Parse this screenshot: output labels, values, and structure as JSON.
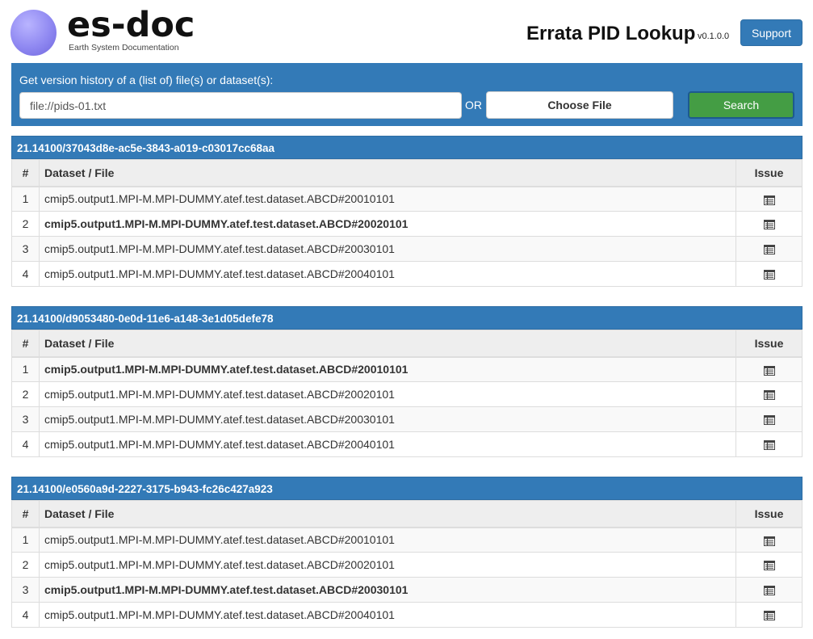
{
  "header": {
    "logo_title": "es-doc",
    "logo_subtitle": "Earth System Documentation",
    "app_title": "Errata PID Lookup",
    "app_version": "v0.1.0.0",
    "support_label": "Support"
  },
  "search": {
    "label": "Get version history of a (list of) file(s) or dataset(s):",
    "input_value": "file://pids-01.txt",
    "or_label": "OR",
    "choose_file_label": "Choose File",
    "search_label": "Search"
  },
  "table_headers": {
    "num": "#",
    "dataset": "Dataset / File",
    "issue": "Issue"
  },
  "results": [
    {
      "pid": "21.14100/37043d8e-ac5e-3843-a019-c03017cc68aa",
      "rows": [
        {
          "num": "1",
          "name": "cmip5.output1.MPI-M.MPI-DUMMY.atef.test.dataset.ABCD#20010101",
          "bold": false,
          "icon": "table-list-icon"
        },
        {
          "num": "2",
          "name": "cmip5.output1.MPI-M.MPI-DUMMY.atef.test.dataset.ABCD#20020101",
          "bold": true,
          "icon": "table-list-icon"
        },
        {
          "num": "3",
          "name": "cmip5.output1.MPI-M.MPI-DUMMY.atef.test.dataset.ABCD#20030101",
          "bold": false,
          "icon": "table-list-icon"
        },
        {
          "num": "4",
          "name": "cmip5.output1.MPI-M.MPI-DUMMY.atef.test.dataset.ABCD#20040101",
          "bold": false,
          "icon": "table-list-icon"
        }
      ]
    },
    {
      "pid": "21.14100/d9053480-0e0d-11e6-a148-3e1d05defe78",
      "rows": [
        {
          "num": "1",
          "name": "cmip5.output1.MPI-M.MPI-DUMMY.atef.test.dataset.ABCD#20010101",
          "bold": true,
          "icon": "table-list-icon"
        },
        {
          "num": "2",
          "name": "cmip5.output1.MPI-M.MPI-DUMMY.atef.test.dataset.ABCD#20020101",
          "bold": false,
          "icon": "table-list-icon"
        },
        {
          "num": "3",
          "name": "cmip5.output1.MPI-M.MPI-DUMMY.atef.test.dataset.ABCD#20030101",
          "bold": false,
          "icon": "table-list-icon"
        },
        {
          "num": "4",
          "name": "cmip5.output1.MPI-M.MPI-DUMMY.atef.test.dataset.ABCD#20040101",
          "bold": false,
          "icon": "table-list-icon"
        }
      ]
    },
    {
      "pid": "21.14100/e0560a9d-2227-3175-b943-fc26c427a923",
      "rows": [
        {
          "num": "1",
          "name": "cmip5.output1.MPI-M.MPI-DUMMY.atef.test.dataset.ABCD#20010101",
          "bold": false,
          "icon": "table-list-icon"
        },
        {
          "num": "2",
          "name": "cmip5.output1.MPI-M.MPI-DUMMY.atef.test.dataset.ABCD#20020101",
          "bold": false,
          "icon": "table-list-icon"
        },
        {
          "num": "3",
          "name": "cmip5.output1.MPI-M.MPI-DUMMY.atef.test.dataset.ABCD#20030101",
          "bold": true,
          "icon": "table-list-icon"
        },
        {
          "num": "4",
          "name": "cmip5.output1.MPI-M.MPI-DUMMY.atef.test.dataset.ABCD#20040101",
          "bold": false,
          "icon": "table-list-icon"
        }
      ]
    }
  ],
  "colors": {
    "primary": "#337ab7",
    "success": "#449d44",
    "logo": "#8f88f1"
  }
}
